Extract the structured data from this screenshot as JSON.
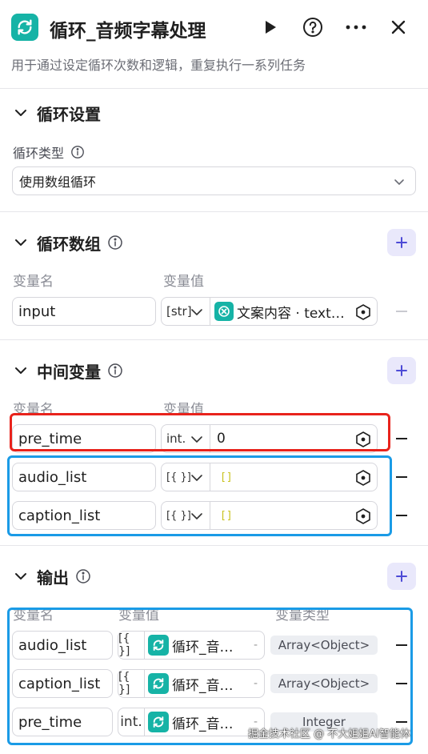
{
  "header": {
    "title": "循环_音频字幕处理",
    "description": "用于通过设定循环次数和逻辑，重复执行一系列任务"
  },
  "loop_settings": {
    "title": "循环设置",
    "type_label": "循环类型",
    "type_value": "使用数组循环"
  },
  "loop_array": {
    "title": "循环数组",
    "col_name": "变量名",
    "col_value": "变量值",
    "rows": [
      {
        "name": "input",
        "type": "[str]",
        "value_ref": "文案内容 · text…"
      }
    ]
  },
  "middle_vars": {
    "title": "中间变量",
    "col_name": "变量名",
    "col_value": "变量值",
    "rows": [
      {
        "name": "pre_time",
        "type": "int.",
        "value": "0"
      },
      {
        "name": "audio_list",
        "type": "[{ }]",
        "value": "[]"
      },
      {
        "name": "caption_list",
        "type": "[{ }]",
        "value": "[]"
      }
    ]
  },
  "output": {
    "title": "输出",
    "col_name": "变量名",
    "col_value": "变量值",
    "col_type": "变量类型",
    "rows": [
      {
        "name": "audio_list",
        "type": "[{ }]",
        "value_ref": "循环_音…",
        "suffix": "-",
        "var_type": "Array<Object>"
      },
      {
        "name": "caption_list",
        "type": "[{ }]",
        "value_ref": "循环_音…",
        "suffix": "-",
        "var_type": "Array<Object>"
      },
      {
        "name": "pre_time",
        "type": "int.",
        "value_ref": "循环_音…",
        "suffix": "-",
        "var_type": "Integer"
      }
    ]
  },
  "watermark": "掘金技术社区 @ 不大姐姐AI智能体",
  "colors": {
    "accent": "#16b3a6",
    "add_button_bg": "#e9e8fb",
    "add_button_icon": "#4d4bd6",
    "highlight_red": "#e8231c",
    "highlight_blue": "#1a9be6"
  }
}
